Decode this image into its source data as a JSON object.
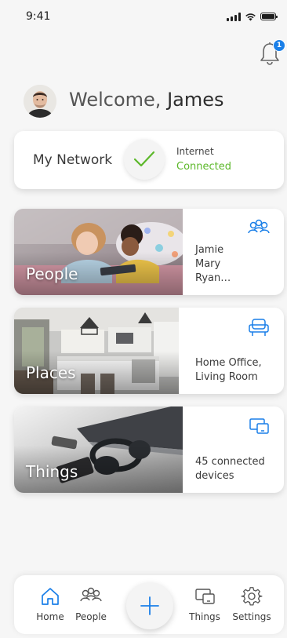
{
  "status_bar": {
    "time": "9:41"
  },
  "notifications": {
    "count": "1",
    "icon": "bell-icon"
  },
  "welcome": {
    "greeting": "Welcome,",
    "name": "James"
  },
  "network": {
    "label": "My Network",
    "connection_title": "Internet",
    "connection_status": "Connected",
    "status_color": "#5cb82a"
  },
  "categories": [
    {
      "label": "People",
      "icon": "people-icon",
      "lines": [
        "Jamie",
        "Mary",
        "Ryan…"
      ]
    },
    {
      "label": "Places",
      "icon": "armchair-icon",
      "lines": [
        "Home Office,",
        "Living Room"
      ]
    },
    {
      "label": "Things",
      "icon": "devices-icon",
      "lines": [
        "45 connected",
        "devices"
      ]
    }
  ],
  "bottom_nav": {
    "items": [
      {
        "label": "Home",
        "icon": "home-icon",
        "active": true
      },
      {
        "label": "People",
        "icon": "people-icon"
      },
      {
        "label": "Things",
        "icon": "devices-icon"
      },
      {
        "label": "Settings",
        "icon": "gear-icon"
      }
    ],
    "add_icon": "plus-icon"
  },
  "colors": {
    "accent": "#1a7fe8",
    "background": "#f6f6f6",
    "card": "#ffffff"
  }
}
